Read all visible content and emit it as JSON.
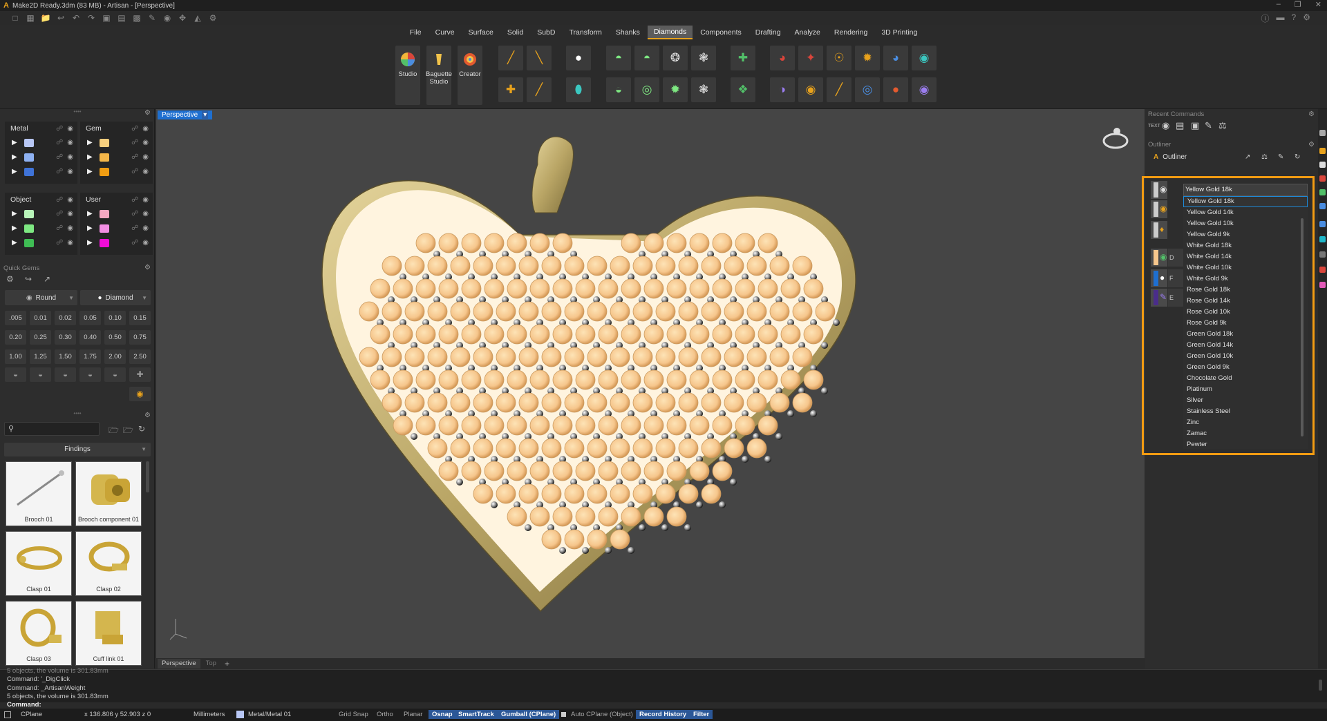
{
  "window": {
    "title": "Make2D Ready.3dm (83 MB) - Artisan - [Perspective]"
  },
  "menu": [
    {
      "label": "File",
      "active": false
    },
    {
      "label": "Curve",
      "active": false
    },
    {
      "label": "Surface",
      "active": false
    },
    {
      "label": "Solid",
      "active": false
    },
    {
      "label": "SubD",
      "active": false
    },
    {
      "label": "Transform",
      "active": false
    },
    {
      "label": "Shanks",
      "active": false
    },
    {
      "label": "Diamonds",
      "active": true
    },
    {
      "label": "Components",
      "active": false
    },
    {
      "label": "Drafting",
      "active": false
    },
    {
      "label": "Analyze",
      "active": false
    },
    {
      "label": "Rendering",
      "active": false
    },
    {
      "label": "3D Printing",
      "active": false
    }
  ],
  "ribbon": {
    "studio": "Studio",
    "baguette": "Baguette Studio",
    "creator": "Creator"
  },
  "layers": {
    "metal": {
      "title": "Metal",
      "colors": [
        "#b8c7f5",
        "#8eb1f2",
        "#3f73d8"
      ]
    },
    "gem": {
      "title": "Gem",
      "colors": [
        "#f6cf7e",
        "#f5b749",
        "#f09d12"
      ]
    },
    "object": {
      "title": "Object",
      "colors": [
        "#b8f4b9",
        "#7ee882",
        "#3fbd54"
      ]
    },
    "user": {
      "title": "User",
      "colors": [
        "#f6a9c2",
        "#f28ee3",
        "#f00cd7"
      ]
    }
  },
  "quick_gems": {
    "title": "Quick Gems",
    "cut": "Round",
    "material": "Diamond",
    "sizes": [
      ".005",
      "0.01",
      "0.02",
      "0.05",
      "0.10",
      "0.15",
      "0.20",
      "0.25",
      "0.30",
      "0.40",
      "0.50",
      "0.75",
      "1.00",
      "1.25",
      "1.50",
      "1.75",
      "2.00",
      "2.50"
    ]
  },
  "library": {
    "search_placeholder": "",
    "category": "Findings",
    "items": [
      "Brooch 01",
      "Brooch component 01",
      "Clasp 01",
      "Clasp 02",
      "Clasp 03",
      "Cuff link 01"
    ]
  },
  "viewport": {
    "title": "Perspective",
    "tabs": [
      "Perspective",
      "Top"
    ]
  },
  "right": {
    "recent_title": "Recent Commands",
    "text_label": "TEXT",
    "outliner_title": "Outliner",
    "outliner_tab": "Outliner",
    "current_material": "Yellow Gold 18k",
    "row_letters": [
      "D",
      "F",
      "E"
    ],
    "materials": [
      "Yellow Gold 18k",
      "Yellow Gold 14k",
      "Yellow Gold 10k",
      "Yellow Gold 9k",
      "White Gold 18k",
      "White Gold 14k",
      "White Gold 10k",
      "White Gold 9k",
      "Rose Gold 18k",
      "Rose Gold 14k",
      "Rose Gold 10k",
      "Rose Gold 9k",
      "Green Gold 18k",
      "Green Gold 14k",
      "Green Gold 10k",
      "Green Gold 9k",
      "Chocolate Gold",
      "Platinum",
      "Silver",
      "Stainless Steel",
      "Zinc",
      "Zamac",
      "Pewter"
    ]
  },
  "command": {
    "lines": [
      "5 objects, the volume is 301.83mm",
      "Command: '_DigClick",
      "Command: _ArtisanWeight",
      "5 objects, the volume is 301.83mm"
    ],
    "prompt": "Command:"
  },
  "status": {
    "cplane": "CPlane",
    "coords": "x 136.806  y 52.903  z 0",
    "units": "Millimeters",
    "layer": "Metal/Metal 01",
    "grid_snap": "Grid Snap",
    "ortho": "Ortho",
    "planar": "Planar",
    "osnap": "Osnap",
    "smarttrack": "SmartTrack",
    "gumball": "Gumball (CPlane)",
    "auto_cplane": "Auto CPlane (Object)",
    "record_history": "Record History",
    "filter": "Filter"
  },
  "colors": {
    "accent": "#f39c12",
    "selection": "#1e6fd0",
    "gold": "#c9b377",
    "gem": "#f6c68c"
  }
}
